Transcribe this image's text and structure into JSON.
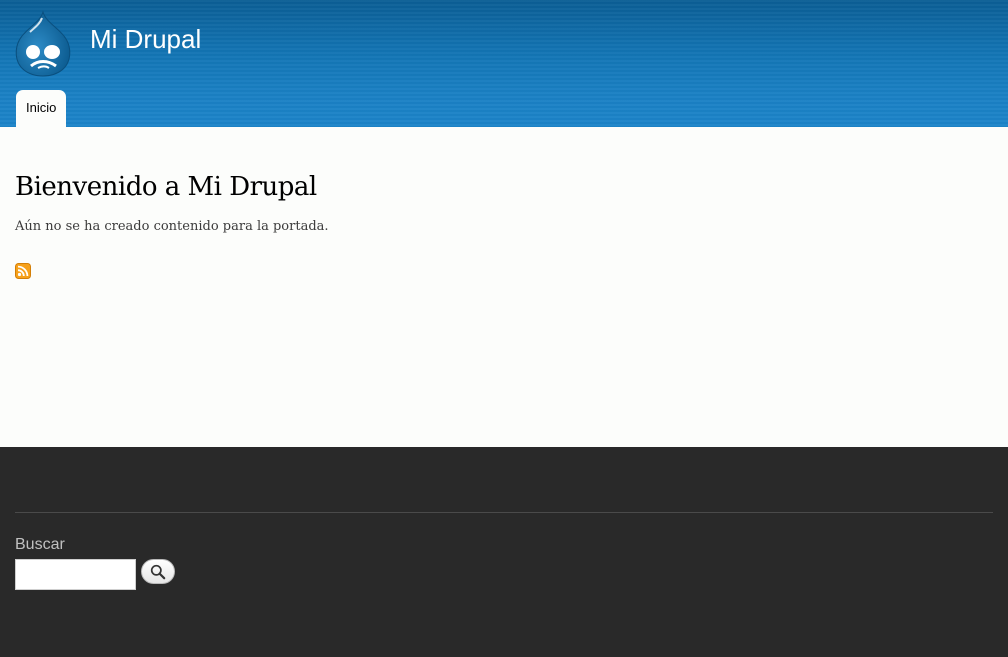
{
  "header": {
    "site_name": "Mi Drupal",
    "logo_icon": "drupal-drop-logo-icon",
    "menu": [
      {
        "label": "Inicio"
      }
    ]
  },
  "main": {
    "title": "Bienvenido a Mi Drupal",
    "no_content_text": "Aún no se ha creado contenido para la portada.",
    "feed_icon": "rss-feed-icon"
  },
  "footer": {
    "search": {
      "title": "Buscar",
      "input_value": "",
      "button_icon": "search-icon"
    }
  },
  "colors": {
    "header_top": "#0b5e95",
    "header_bottom": "#1c84c9",
    "page_background": "#fcfdfb",
    "footer_background": "#292929",
    "feed_orange": "#f6a11b"
  }
}
